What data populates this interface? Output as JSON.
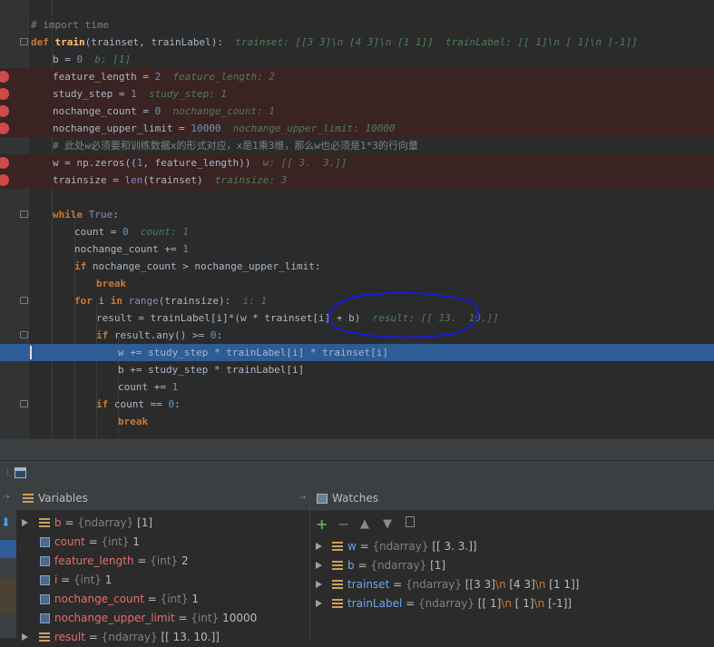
{
  "editor": {
    "lines": [
      {
        "segs": [
          {
            "t": "# import time",
            "c": "cm"
          }
        ]
      },
      {
        "segs": [
          {
            "t": "def ",
            "c": "kw"
          },
          {
            "t": "train",
            "c": "fn"
          },
          {
            "t": "(trainset, trainLabel):",
            "c": ""
          },
          {
            "t": "  trainset: [[3 3]\\n [4 3]\\n [1 1]]  trainLabel: [[ 1]\\n [ 1]\\n [-1]]",
            "c": "inl"
          }
        ]
      },
      {
        "segs": [
          {
            "t": "b",
            "c": ""
          },
          {
            "t": " = ",
            "c": ""
          },
          {
            "t": "0",
            "c": "num"
          },
          {
            "t": "  b: [1]",
            "c": "inl"
          }
        ]
      },
      {
        "segs": [
          {
            "t": "feature_length = ",
            "c": ""
          },
          {
            "t": "2",
            "c": "num"
          },
          {
            "t": "  feature_length: 2",
            "c": "inl"
          }
        ]
      },
      {
        "segs": [
          {
            "t": "study_step = ",
            "c": ""
          },
          {
            "t": "1",
            "c": "num"
          },
          {
            "t": "  study_step: 1",
            "c": "inl"
          }
        ]
      },
      {
        "segs": [
          {
            "t": "nochange_count = ",
            "c": ""
          },
          {
            "t": "0",
            "c": "num"
          },
          {
            "t": "  nochange_count: 1",
            "c": "inl"
          }
        ]
      },
      {
        "segs": [
          {
            "t": "nochange_upper_limit = ",
            "c": ""
          },
          {
            "t": "10000",
            "c": "num"
          },
          {
            "t": "  nochange_upper_limit: 10000",
            "c": "inl"
          }
        ]
      },
      {
        "segs": [
          {
            "t": "# 此处w必须要和训练数据x的形式对应，x是1乘3维，那么w也必须是1*3的行向量",
            "c": "cm"
          }
        ]
      },
      {
        "segs": [
          {
            "t": "w = np.zeros((",
            "c": ""
          },
          {
            "t": "1",
            "c": "num"
          },
          {
            "t": ", feature_length))",
            "c": ""
          },
          {
            "t": "  w: [[ 3.  3.]]",
            "c": "inl"
          }
        ]
      },
      {
        "segs": [
          {
            "t": "trainsize = ",
            "c": ""
          },
          {
            "t": "len",
            "c": "bi"
          },
          {
            "t": "(trainset)",
            "c": ""
          },
          {
            "t": "  trainsize: 3",
            "c": "inl"
          }
        ]
      },
      {
        "segs": []
      },
      {
        "segs": [
          {
            "t": "while ",
            "c": "kw"
          },
          {
            "t": "True",
            "c": "bi"
          },
          {
            "t": ":",
            "c": ""
          }
        ]
      },
      {
        "segs": [
          {
            "t": "count = ",
            "c": ""
          },
          {
            "t": "0",
            "c": "num"
          },
          {
            "t": "  count: 1",
            "c": "inl"
          }
        ]
      },
      {
        "segs": [
          {
            "t": "nochange_count += ",
            "c": ""
          },
          {
            "t": "1",
            "c": "num"
          }
        ]
      },
      {
        "segs": [
          {
            "t": "if ",
            "c": "kw"
          },
          {
            "t": "nochange_count > nochange_upper_limit:",
            "c": ""
          }
        ]
      },
      {
        "segs": [
          {
            "t": "break",
            "c": "kw"
          }
        ]
      },
      {
        "segs": [
          {
            "t": "for ",
            "c": "kw"
          },
          {
            "t": "i ",
            "c": ""
          },
          {
            "t": "in ",
            "c": "kw"
          },
          {
            "t": "range",
            "c": "bi"
          },
          {
            "t": "(trainsize):",
            "c": ""
          },
          {
            "t": "  i: 1",
            "c": "inl"
          }
        ]
      },
      {
        "segs": [
          {
            "t": "result = trainLabel[i]*(w * trainset[i] + b)",
            "c": ""
          },
          {
            "t": "  result: [[ 13.  10.]]",
            "c": "inl"
          }
        ]
      },
      {
        "segs": [
          {
            "t": "if ",
            "c": "kw"
          },
          {
            "t": "result.any() >= ",
            "c": ""
          },
          {
            "t": "0",
            "c": "num"
          },
          {
            "t": ":",
            "c": ""
          }
        ]
      },
      {
        "segs": [
          {
            "t": "w += study_step * trainLabel[i] * trainset[i]",
            "c": ""
          }
        ]
      },
      {
        "segs": [
          {
            "t": "b += study_step * trainLabel[i]",
            "c": ""
          }
        ]
      },
      {
        "segs": [
          {
            "t": "count += ",
            "c": ""
          },
          {
            "t": "1",
            "c": "num"
          }
        ]
      },
      {
        "segs": [
          {
            "t": "if ",
            "c": "kw"
          },
          {
            "t": "count == ",
            "c": ""
          },
          {
            "t": "0",
            "c": "num"
          },
          {
            "t": ":",
            "c": ""
          }
        ]
      },
      {
        "segs": [
          {
            "t": "break",
            "c": "kw"
          }
        ]
      }
    ]
  },
  "variables": {
    "title": "Variables",
    "items": [
      {
        "name": "b",
        "type": "{ndarray}",
        "value": "[1]"
      },
      {
        "name": "count",
        "type": "{int}",
        "value": "1"
      },
      {
        "name": "feature_length",
        "type": "{int}",
        "value": "2"
      },
      {
        "name": "i",
        "type": "{int}",
        "value": "1"
      },
      {
        "name": "nochange_count",
        "type": "{int}",
        "value": "1"
      },
      {
        "name": "nochange_upper_limit",
        "type": "{int}",
        "value": "10000"
      },
      {
        "name": "result",
        "type": "{ndarray}",
        "value": "[[ 13.  10.]]"
      }
    ]
  },
  "watches": {
    "title": "Watches",
    "add_symbol": "+",
    "remove_symbol": "−",
    "items": [
      {
        "name": "w",
        "type": "{ndarray}",
        "value": [
          {
            "t": "[[ 3.  3.]]",
            "c": ""
          }
        ]
      },
      {
        "name": "b",
        "type": "{ndarray}",
        "value": [
          {
            "t": "[1]",
            "c": ""
          }
        ]
      },
      {
        "name": "trainset",
        "type": "{ndarray}",
        "value": [
          {
            "t": "[[3 3]",
            "c": ""
          },
          {
            "t": "\\n",
            "c": "esc"
          },
          {
            "t": " [4 3]",
            "c": ""
          },
          {
            "t": "\\n",
            "c": "esc"
          },
          {
            "t": " [1 1]]",
            "c": ""
          }
        ]
      },
      {
        "name": "trainLabel",
        "type": "{ndarray}",
        "value": [
          {
            "t": "[[ 1]",
            "c": ""
          },
          {
            "t": "\\n",
            "c": "esc"
          },
          {
            "t": " [ 1]",
            "c": ""
          },
          {
            "t": "\\n",
            "c": "esc"
          },
          {
            "t": " [-1]]",
            "c": ""
          }
        ]
      }
    ]
  },
  "colors": {
    "breakpoint": "#d14a4a",
    "current_line": "#2d5c96",
    "annotation": "#1a1ae0",
    "add_green": "#59a869"
  }
}
